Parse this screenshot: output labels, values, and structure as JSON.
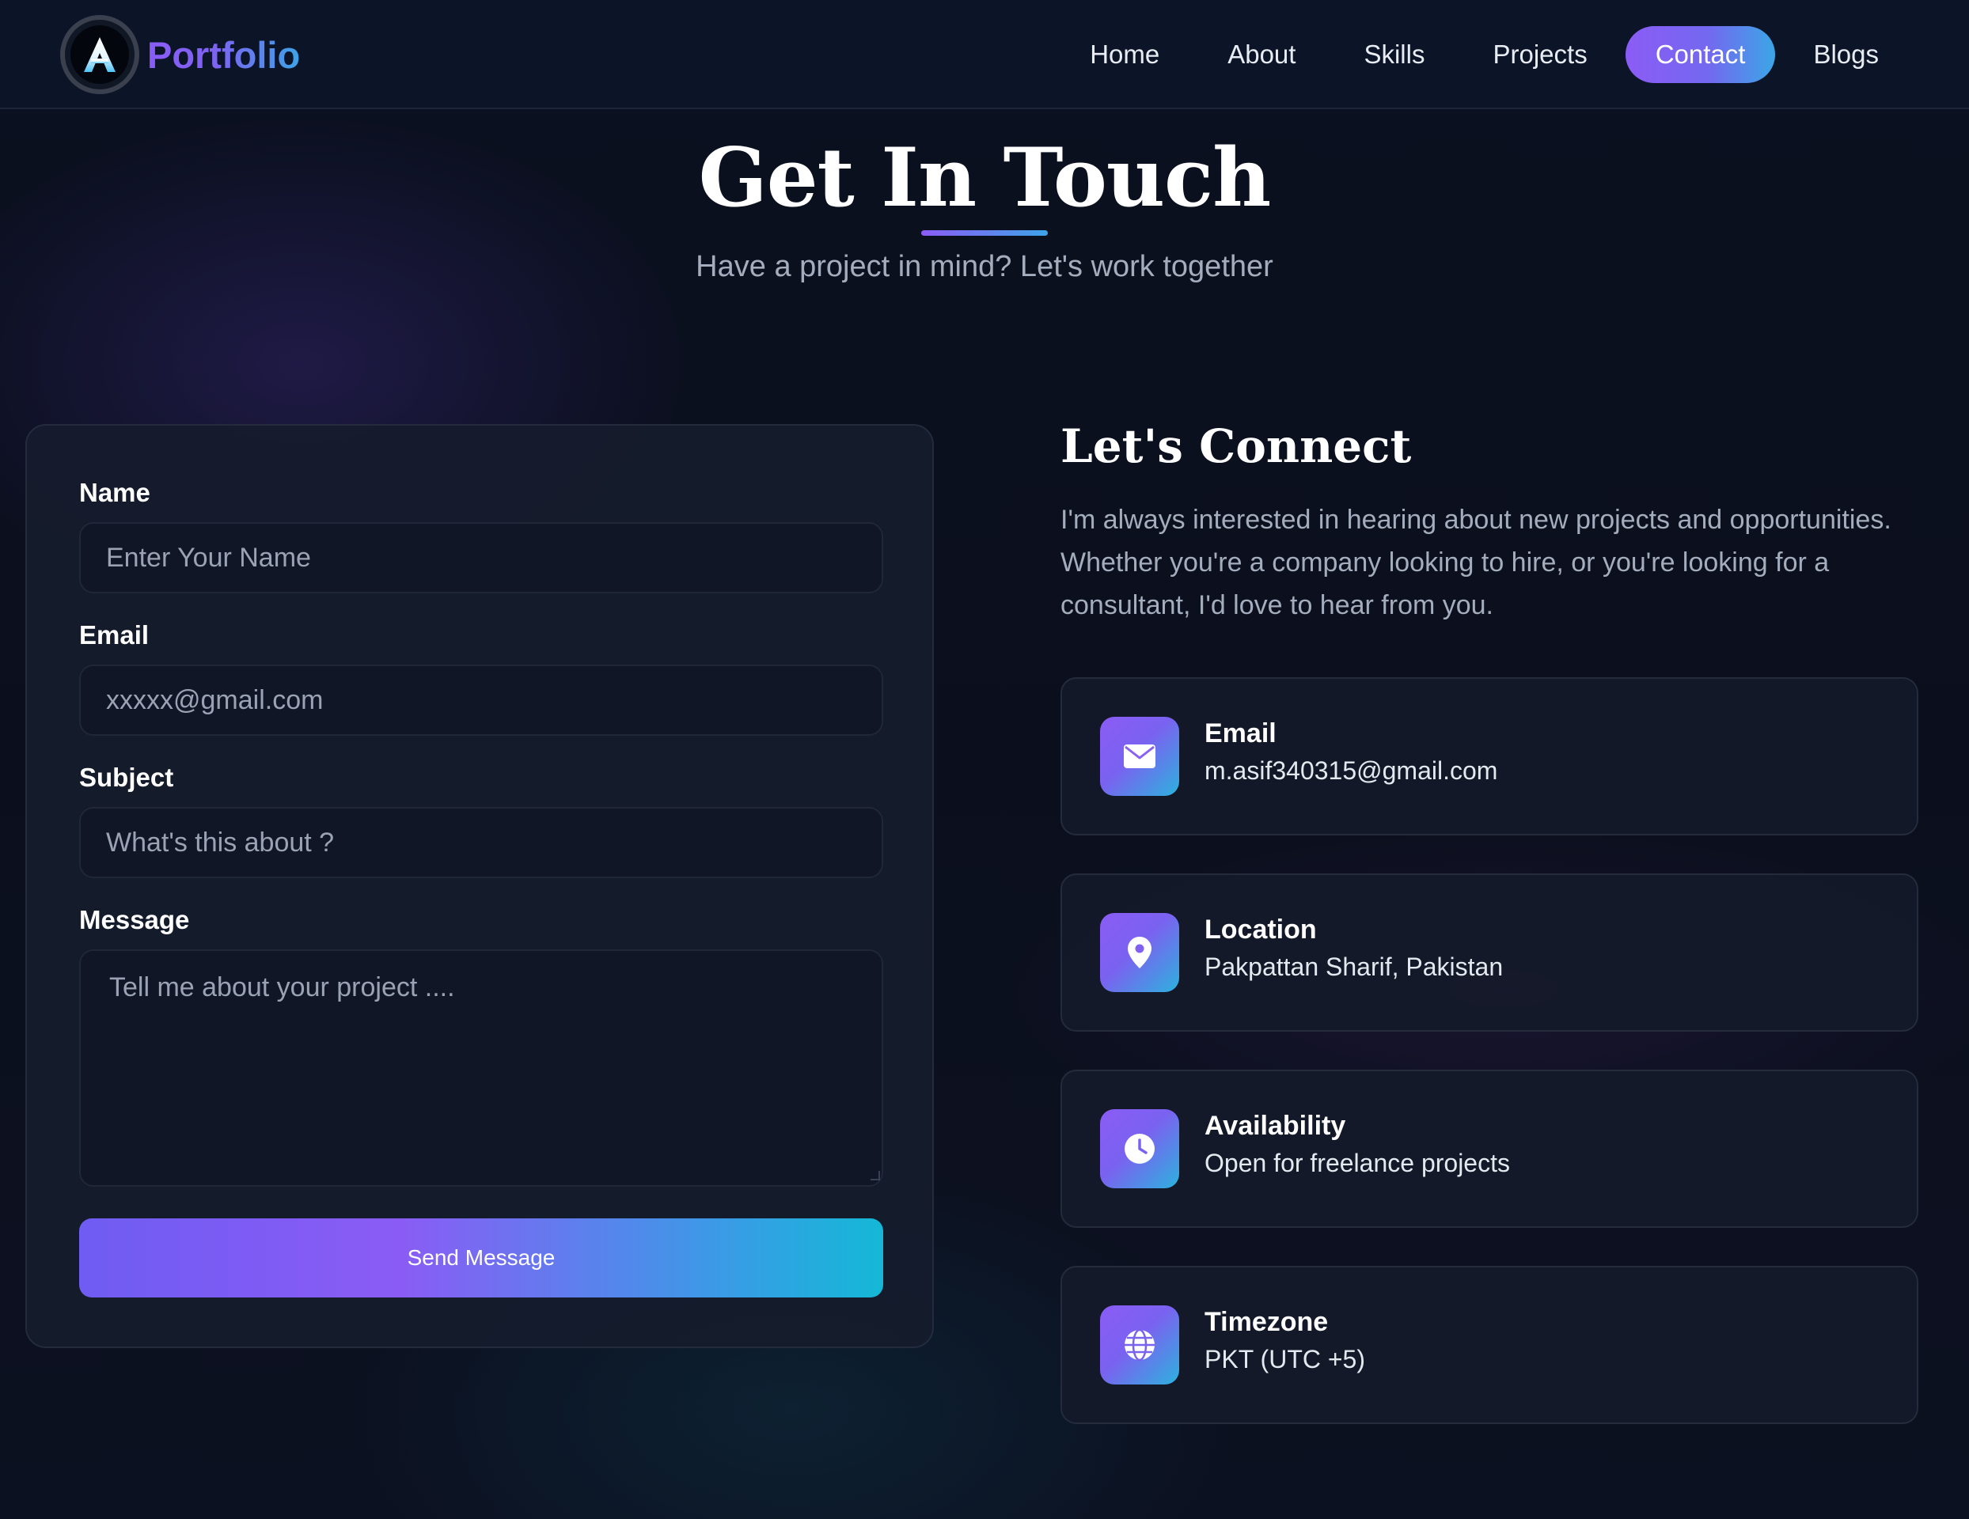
{
  "brand": {
    "name": "Portfolio",
    "logo_letter": "A",
    "logo_icon": "letter-a-logo"
  },
  "nav": {
    "items": [
      {
        "label": "Home"
      },
      {
        "label": "About"
      },
      {
        "label": "Skills"
      },
      {
        "label": "Projects"
      },
      {
        "label": "Contact",
        "active": true
      },
      {
        "label": "Blogs"
      }
    ]
  },
  "hero": {
    "title": "Get In Touch",
    "subtitle": "Have a project in mind? Let's work together"
  },
  "form": {
    "name": {
      "label": "Name",
      "placeholder": "Enter Your Name"
    },
    "email": {
      "label": "Email",
      "placeholder": "xxxxx@gmail.com"
    },
    "subject": {
      "label": "Subject",
      "placeholder": "What's this about ?"
    },
    "message": {
      "label": "Message",
      "placeholder": "Tell me about your project ...."
    },
    "submit_label": "Send Message"
  },
  "connect": {
    "title": "Let's Connect",
    "description": "I'm always interested in hearing about new projects and opportunities. Whether you're a company looking to hire, or you're looking for a consultant, I'd love to hear from you.",
    "items": [
      {
        "label": "Email",
        "value": "m.asif340315@gmail.com",
        "icon": "envelope-icon"
      },
      {
        "label": "Location",
        "value": "Pakpattan Sharif, Pakistan",
        "icon": "map-pin-icon"
      },
      {
        "label": "Availability",
        "value": "Open for freelance projects",
        "icon": "clock-icon"
      },
      {
        "label": "Timezone",
        "value": "PKT (UTC +5)",
        "icon": "globe-icon"
      }
    ]
  },
  "colors": {
    "accent_purple": "#8b5cf6",
    "accent_cyan": "#14b8d6",
    "background": "#0b1020",
    "card": "#161c2c",
    "muted_text": "#a4adbd"
  }
}
